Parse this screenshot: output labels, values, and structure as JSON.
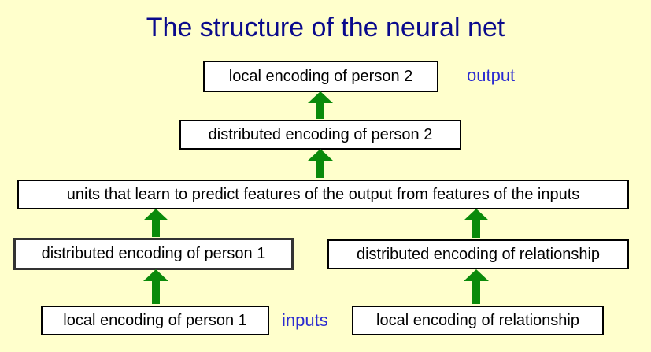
{
  "title": "The structure of the neural net",
  "nodes": {
    "local_person2": "local encoding of person 2",
    "distributed_person2": "distributed encoding of person 2",
    "units": "units that learn to predict features of the output from features of the inputs",
    "distributed_person1": "distributed encoding of person 1",
    "distributed_relationship": "distributed encoding of relationship",
    "local_person1": "local encoding of person 1",
    "local_relationship": "local encoding of relationship"
  },
  "labels": {
    "output": "output",
    "inputs": "inputs"
  },
  "colors": {
    "background": "#ffffcc",
    "title": "#0a0a8c",
    "label": "#2b2bd1",
    "arrow": "#0a8a0a"
  }
}
